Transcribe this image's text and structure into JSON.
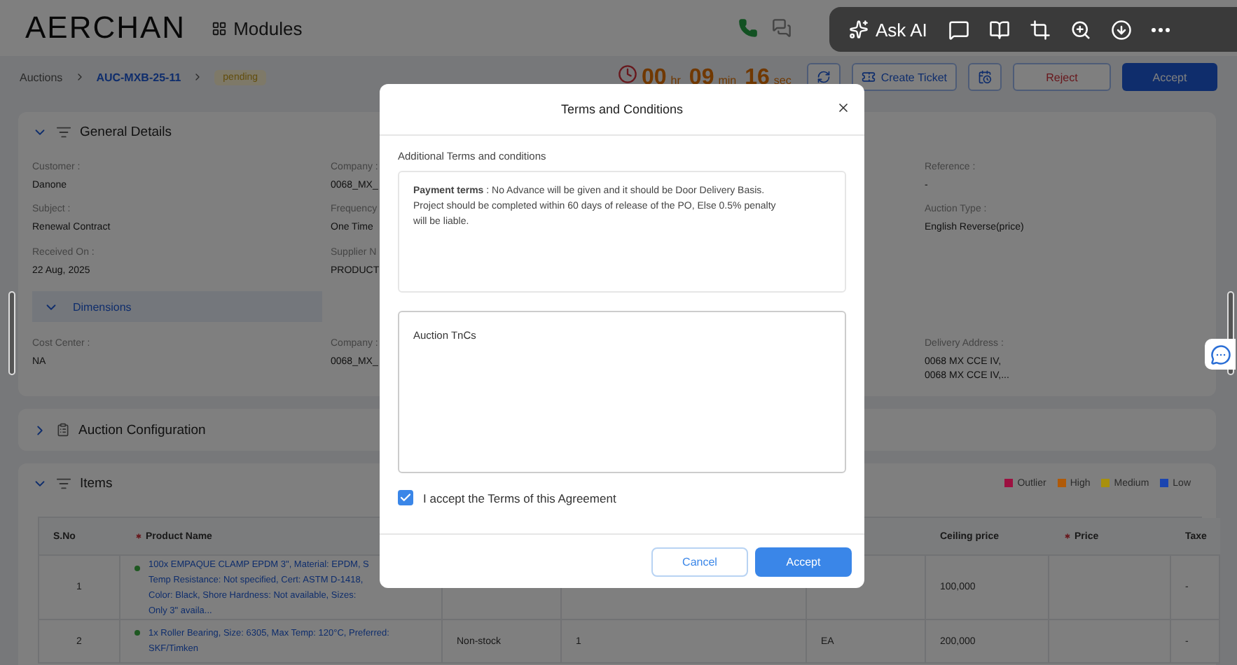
{
  "header": {
    "logo": "AERCHAN",
    "modules": "Modules"
  },
  "browser_toolbar": {
    "ask_ai": "Ask AI"
  },
  "breadcrumb": {
    "items": [
      "Auctions",
      "AUC-MXB-25-11"
    ],
    "status": "pending"
  },
  "timer": [
    {
      "value": "00",
      "unit": "hr"
    },
    {
      "value": "09",
      "unit": "min"
    },
    {
      "value": "16",
      "unit": "sec"
    }
  ],
  "actions": {
    "create_ticket": "Create Ticket",
    "reject": "Reject",
    "accept": "Accept"
  },
  "general_details": {
    "title": "General Details",
    "expanded": true,
    "columns": [
      {
        "fields": [
          {
            "label": "Customer :",
            "value": "Danone"
          },
          {
            "label": "Subject :",
            "value": "Renewal Contract"
          },
          {
            "label": "Received On :",
            "value": "22 Aug, 2025"
          }
        ]
      },
      {
        "fields": [
          {
            "label": "Company :",
            "value": "0068_MX_"
          },
          {
            "label": "Frequency",
            "value": "One Time"
          },
          {
            "label": "Supplier N",
            "value": "PRODUCT"
          }
        ]
      },
      {
        "fields": [
          {
            "label": "Reference :",
            "value": "-"
          },
          {
            "label": "Auction Type :",
            "value": "English Reverse(price)"
          }
        ]
      }
    ],
    "dimensions": {
      "title": "Dimensions",
      "expanded": true,
      "columns": [
        {
          "fields": [
            {
              "label": "Cost Center :",
              "value": "NA"
            }
          ]
        },
        {
          "fields": [
            {
              "label": "Company :",
              "value": "0068_MX_"
            }
          ]
        },
        {
          "fields": [
            {
              "label": "Delivery Address :",
              "value": "0068 MX CCE IV,\n0068 MX CCE IV,..."
            }
          ]
        }
      ]
    }
  },
  "auction_configuration": {
    "title": "Auction Configuration",
    "expanded": false
  },
  "items": {
    "title": "Items",
    "expanded": true,
    "legend": [
      {
        "label": "Outlier",
        "color": "#9c1040"
      },
      {
        "label": "High",
        "color": "#b05a08"
      },
      {
        "label": "Medium",
        "color": "#a8900c"
      },
      {
        "label": "Low",
        "color": "#1b45b0"
      }
    ],
    "columns": [
      {
        "label": "S.No",
        "required": false
      },
      {
        "label": "Product Name",
        "required": true
      },
      {
        "label": "Ceiling price",
        "required": false
      },
      {
        "label": "Price",
        "required": true
      },
      {
        "label": "Taxe",
        "required": false
      }
    ],
    "rows": [
      {
        "s_no": "1",
        "product_name": "100x EMPAQUE CLAMP EPDM 3\", Material: EPDM, S Temp Resistance: Not specified, Cert: ASTM D-1418, Color: Black, Shore Hardness: Not available, Sizes: Only 3\" availa...",
        "ceiling_price": "100,000",
        "column_8": "-"
      },
      {
        "s_no": "2",
        "product_name": "1x Roller Bearing, Size: 6305, Max Temp: 120°C, Preferred: SKF/Timken",
        "column_3": "Non-stock",
        "column_4": "1",
        "column_5": "EA",
        "ceiling_price": "200,000",
        "column_8": "-"
      }
    ]
  },
  "modal": {
    "title": "Terms and Conditions",
    "section_label": "Additional Terms and conditions",
    "terms": "**Payment terms** : No Advance will be given and it should be Door Delivery Basis. Project should be completed within 60 days of release of the PO, Else 0.5% penalty will be liable.",
    "auction_terms": "Auction TnCs",
    "agreement": {
      "label": "I accept the Terms of this Agreement",
      "checked": true
    },
    "buttons": {
      "cancel": "Cancel",
      "accept": "Accept"
    }
  }
}
